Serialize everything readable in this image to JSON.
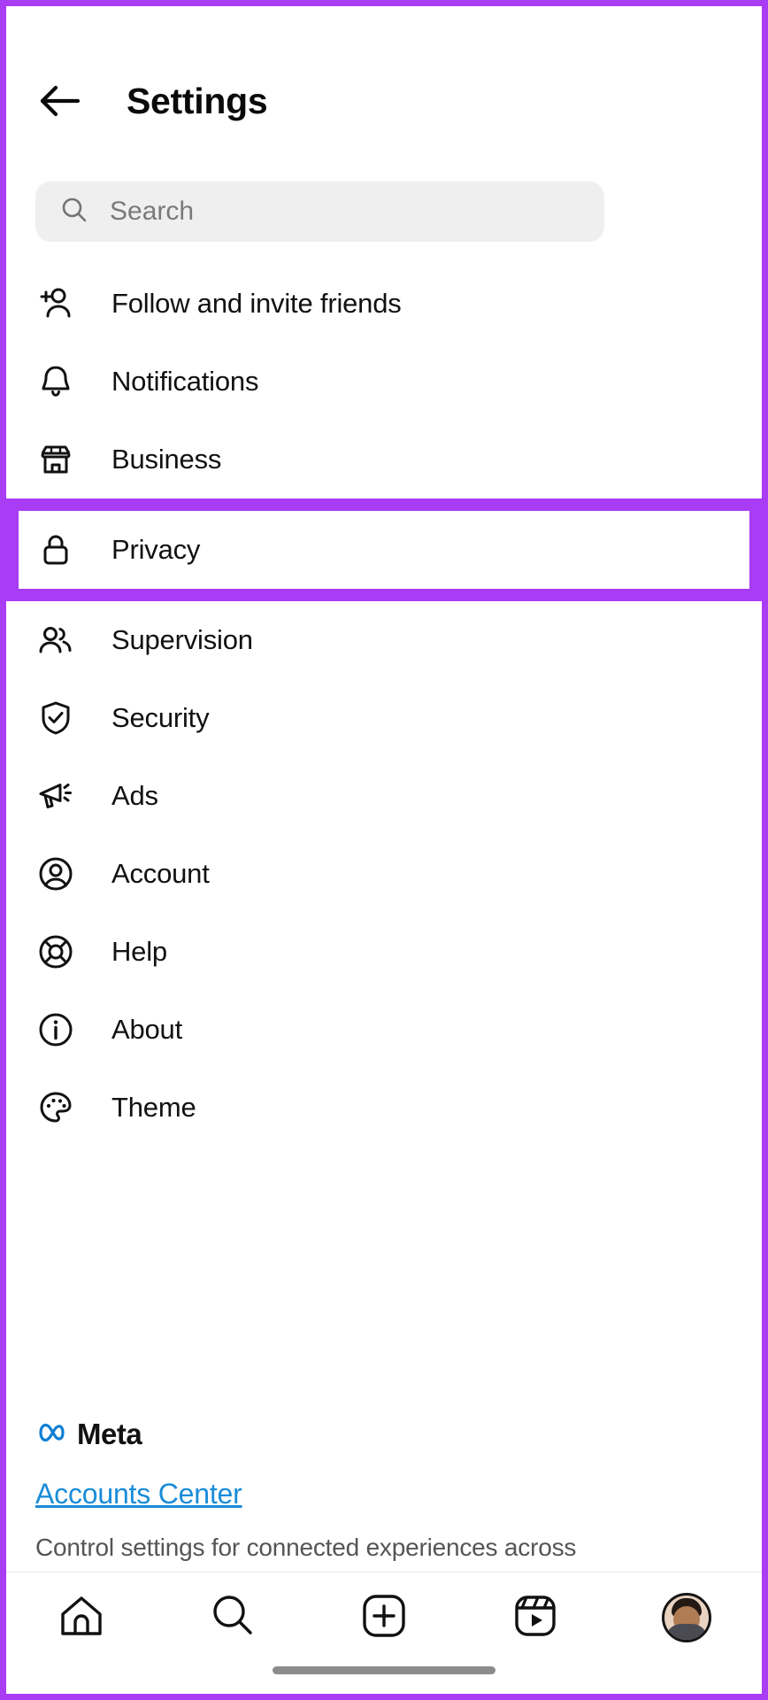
{
  "app": "Instagram",
  "highlight_color": "#a93cf5",
  "header": {
    "title": "Settings",
    "back_icon": "arrow-left-icon"
  },
  "search": {
    "placeholder": "Search",
    "value": "",
    "icon": "search-icon"
  },
  "menu": {
    "items": [
      {
        "label": "Follow and invite friends",
        "icon": "person-add-icon",
        "highlighted": false
      },
      {
        "label": "Notifications",
        "icon": "bell-icon",
        "highlighted": false
      },
      {
        "label": "Business",
        "icon": "storefront-icon",
        "highlighted": false
      },
      {
        "label": "Privacy",
        "icon": "lock-icon",
        "highlighted": true
      },
      {
        "label": "Supervision",
        "icon": "people-icon",
        "highlighted": false
      },
      {
        "label": "Security",
        "icon": "shield-check-icon",
        "highlighted": false
      },
      {
        "label": "Ads",
        "icon": "megaphone-icon",
        "highlighted": false
      },
      {
        "label": "Account",
        "icon": "account-circle-icon",
        "highlighted": false
      },
      {
        "label": "Help",
        "icon": "lifebuoy-icon",
        "highlighted": false
      },
      {
        "label": "About",
        "icon": "info-circle-icon",
        "highlighted": false
      },
      {
        "label": "Theme",
        "icon": "palette-icon",
        "highlighted": false
      }
    ]
  },
  "meta_section": {
    "brand": "Meta",
    "brand_icon": "meta-infinity-icon",
    "brand_color": "#0f7fd4",
    "link": "Accounts Center",
    "link_color": "#1a8cd8",
    "description": "Control settings for connected experiences across"
  },
  "bottom_nav": {
    "items": [
      {
        "icon": "home-icon",
        "name": "nav-home"
      },
      {
        "icon": "search-icon",
        "name": "nav-search"
      },
      {
        "icon": "plus-square-icon",
        "name": "nav-create"
      },
      {
        "icon": "reels-icon",
        "name": "nav-reels"
      },
      {
        "icon": "avatar",
        "name": "nav-profile"
      }
    ]
  }
}
